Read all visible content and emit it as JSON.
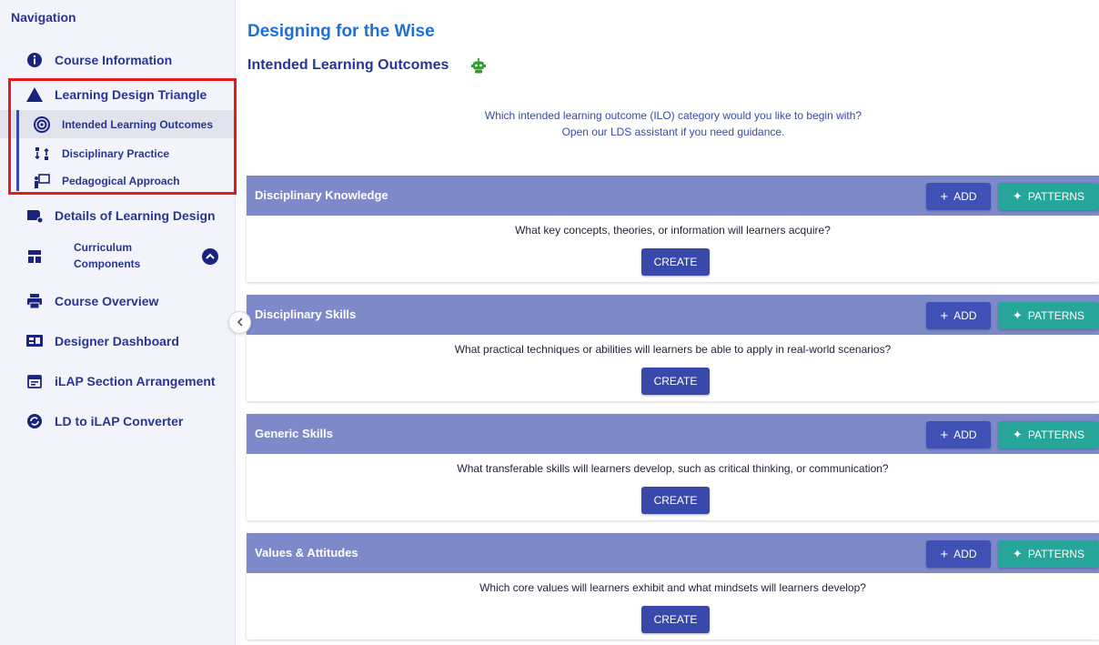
{
  "sidebar": {
    "title": "Navigation",
    "items": [
      {
        "label": "Course Information"
      },
      {
        "label": "Learning Design Triangle"
      },
      {
        "label": "Intended Learning Outcomes"
      },
      {
        "label": "Disciplinary Practice"
      },
      {
        "label": "Pedagogical Approach"
      },
      {
        "label": "Details of Learning Design"
      },
      {
        "label": "Curriculum",
        "label2": "Components"
      },
      {
        "label": "Course Overview"
      },
      {
        "label": "Designer Dashboard"
      },
      {
        "label": "iLAP Section Arrangement"
      },
      {
        "label": "LD to iLAP Converter"
      }
    ]
  },
  "main": {
    "title": "Designing for the Wise",
    "subtitle": "Intended Learning Outcomes",
    "prompt_line1": "Which intended learning outcome (ILO) category would you like to begin with?",
    "prompt_line2": "Open our LDS assistant if you need guidance.",
    "add_label": "ADD",
    "patterns_label": "PATTERNS",
    "create_label": "CREATE",
    "sections": [
      {
        "title": "Disciplinary Knowledge",
        "question": "What key concepts, theories, or information will learners acquire?"
      },
      {
        "title": "Disciplinary Skills",
        "question": "What practical techniques or abilities will learners be able to apply in real-world scenarios?"
      },
      {
        "title": "Generic Skills",
        "question": "What transferable skills will learners develop, such as critical thinking, or communication?"
      },
      {
        "title": "Values & Attitudes",
        "question": "Which core values will learners exhibit and what mindsets will learners develop?"
      }
    ]
  },
  "colors": {
    "accent": "#3f51b5",
    "header": "#7d89c8",
    "patterns": "#26a69a",
    "highlight": "#e31b1b",
    "title": "#1e6fd9"
  }
}
